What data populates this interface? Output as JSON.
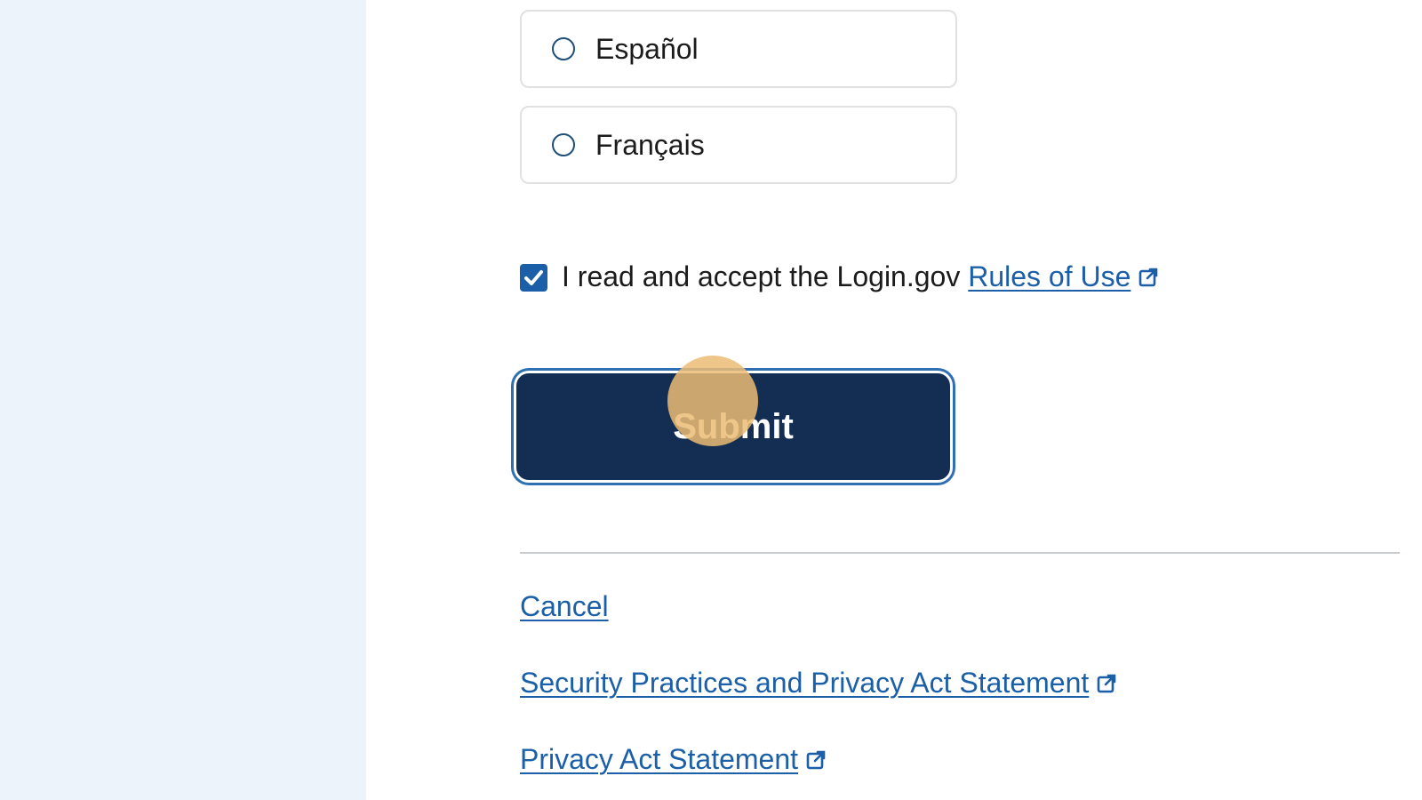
{
  "language_options": [
    {
      "label": "Español",
      "selected": false
    },
    {
      "label": "Français",
      "selected": false
    }
  ],
  "accept": {
    "checked": true,
    "text": "I read and accept the Login.gov ",
    "link_label": "Rules of Use",
    "link_icon": "external-link-icon"
  },
  "submit": {
    "label": "Submit"
  },
  "footer": {
    "cancel_label": "Cancel",
    "security_label": "Security Practices and Privacy Act Statement",
    "privacy_label": "Privacy Act Statement"
  },
  "colors": {
    "accent": "#1a5fa8",
    "button": "#142d52",
    "sidebar": "#ecf3fb",
    "click_marker": "#ecbc74"
  }
}
